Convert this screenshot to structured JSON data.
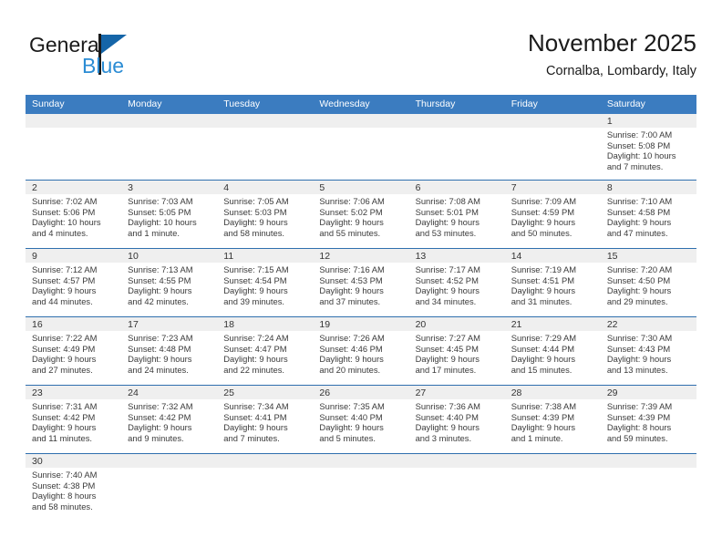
{
  "logo": {
    "text_primary": "General",
    "text_secondary": "Blue",
    "color_primary": "#1a1a1a",
    "color_secondary": "#2b8cd4",
    "triangle_color": "#1565a8"
  },
  "header": {
    "title": "November 2025",
    "subtitle": "Cornalba, Lombardy, Italy"
  },
  "theme": {
    "header_row_bg": "#3b7cc0",
    "row_divider": "#2f6fae",
    "daynum_band_bg": "#efefef",
    "text_color": "#3a3a3a"
  },
  "weekdays": [
    "Sunday",
    "Monday",
    "Tuesday",
    "Wednesday",
    "Thursday",
    "Friday",
    "Saturday"
  ],
  "weeks": [
    {
      "days": [
        {
          "num": "",
          "info": ""
        },
        {
          "num": "",
          "info": ""
        },
        {
          "num": "",
          "info": ""
        },
        {
          "num": "",
          "info": ""
        },
        {
          "num": "",
          "info": ""
        },
        {
          "num": "",
          "info": ""
        },
        {
          "num": "1",
          "info": "Sunrise: 7:00 AM\nSunset: 5:08 PM\nDaylight: 10 hours\nand 7 minutes."
        }
      ]
    },
    {
      "days": [
        {
          "num": "2",
          "info": "Sunrise: 7:02 AM\nSunset: 5:06 PM\nDaylight: 10 hours\nand 4 minutes."
        },
        {
          "num": "3",
          "info": "Sunrise: 7:03 AM\nSunset: 5:05 PM\nDaylight: 10 hours\nand 1 minute."
        },
        {
          "num": "4",
          "info": "Sunrise: 7:05 AM\nSunset: 5:03 PM\nDaylight: 9 hours\nand 58 minutes."
        },
        {
          "num": "5",
          "info": "Sunrise: 7:06 AM\nSunset: 5:02 PM\nDaylight: 9 hours\nand 55 minutes."
        },
        {
          "num": "6",
          "info": "Sunrise: 7:08 AM\nSunset: 5:01 PM\nDaylight: 9 hours\nand 53 minutes."
        },
        {
          "num": "7",
          "info": "Sunrise: 7:09 AM\nSunset: 4:59 PM\nDaylight: 9 hours\nand 50 minutes."
        },
        {
          "num": "8",
          "info": "Sunrise: 7:10 AM\nSunset: 4:58 PM\nDaylight: 9 hours\nand 47 minutes."
        }
      ]
    },
    {
      "days": [
        {
          "num": "9",
          "info": "Sunrise: 7:12 AM\nSunset: 4:57 PM\nDaylight: 9 hours\nand 44 minutes."
        },
        {
          "num": "10",
          "info": "Sunrise: 7:13 AM\nSunset: 4:55 PM\nDaylight: 9 hours\nand 42 minutes."
        },
        {
          "num": "11",
          "info": "Sunrise: 7:15 AM\nSunset: 4:54 PM\nDaylight: 9 hours\nand 39 minutes."
        },
        {
          "num": "12",
          "info": "Sunrise: 7:16 AM\nSunset: 4:53 PM\nDaylight: 9 hours\nand 37 minutes."
        },
        {
          "num": "13",
          "info": "Sunrise: 7:17 AM\nSunset: 4:52 PM\nDaylight: 9 hours\nand 34 minutes."
        },
        {
          "num": "14",
          "info": "Sunrise: 7:19 AM\nSunset: 4:51 PM\nDaylight: 9 hours\nand 31 minutes."
        },
        {
          "num": "15",
          "info": "Sunrise: 7:20 AM\nSunset: 4:50 PM\nDaylight: 9 hours\nand 29 minutes."
        }
      ]
    },
    {
      "days": [
        {
          "num": "16",
          "info": "Sunrise: 7:22 AM\nSunset: 4:49 PM\nDaylight: 9 hours\nand 27 minutes."
        },
        {
          "num": "17",
          "info": "Sunrise: 7:23 AM\nSunset: 4:48 PM\nDaylight: 9 hours\nand 24 minutes."
        },
        {
          "num": "18",
          "info": "Sunrise: 7:24 AM\nSunset: 4:47 PM\nDaylight: 9 hours\nand 22 minutes."
        },
        {
          "num": "19",
          "info": "Sunrise: 7:26 AM\nSunset: 4:46 PM\nDaylight: 9 hours\nand 20 minutes."
        },
        {
          "num": "20",
          "info": "Sunrise: 7:27 AM\nSunset: 4:45 PM\nDaylight: 9 hours\nand 17 minutes."
        },
        {
          "num": "21",
          "info": "Sunrise: 7:29 AM\nSunset: 4:44 PM\nDaylight: 9 hours\nand 15 minutes."
        },
        {
          "num": "22",
          "info": "Sunrise: 7:30 AM\nSunset: 4:43 PM\nDaylight: 9 hours\nand 13 minutes."
        }
      ]
    },
    {
      "days": [
        {
          "num": "23",
          "info": "Sunrise: 7:31 AM\nSunset: 4:42 PM\nDaylight: 9 hours\nand 11 minutes."
        },
        {
          "num": "24",
          "info": "Sunrise: 7:32 AM\nSunset: 4:42 PM\nDaylight: 9 hours\nand 9 minutes."
        },
        {
          "num": "25",
          "info": "Sunrise: 7:34 AM\nSunset: 4:41 PM\nDaylight: 9 hours\nand 7 minutes."
        },
        {
          "num": "26",
          "info": "Sunrise: 7:35 AM\nSunset: 4:40 PM\nDaylight: 9 hours\nand 5 minutes."
        },
        {
          "num": "27",
          "info": "Sunrise: 7:36 AM\nSunset: 4:40 PM\nDaylight: 9 hours\nand 3 minutes."
        },
        {
          "num": "28",
          "info": "Sunrise: 7:38 AM\nSunset: 4:39 PM\nDaylight: 9 hours\nand 1 minute."
        },
        {
          "num": "29",
          "info": "Sunrise: 7:39 AM\nSunset: 4:39 PM\nDaylight: 8 hours\nand 59 minutes."
        }
      ]
    },
    {
      "days": [
        {
          "num": "30",
          "info": "Sunrise: 7:40 AM\nSunset: 4:38 PM\nDaylight: 8 hours\nand 58 minutes."
        },
        {
          "num": "",
          "info": ""
        },
        {
          "num": "",
          "info": ""
        },
        {
          "num": "",
          "info": ""
        },
        {
          "num": "",
          "info": ""
        },
        {
          "num": "",
          "info": ""
        },
        {
          "num": "",
          "info": ""
        }
      ]
    }
  ]
}
